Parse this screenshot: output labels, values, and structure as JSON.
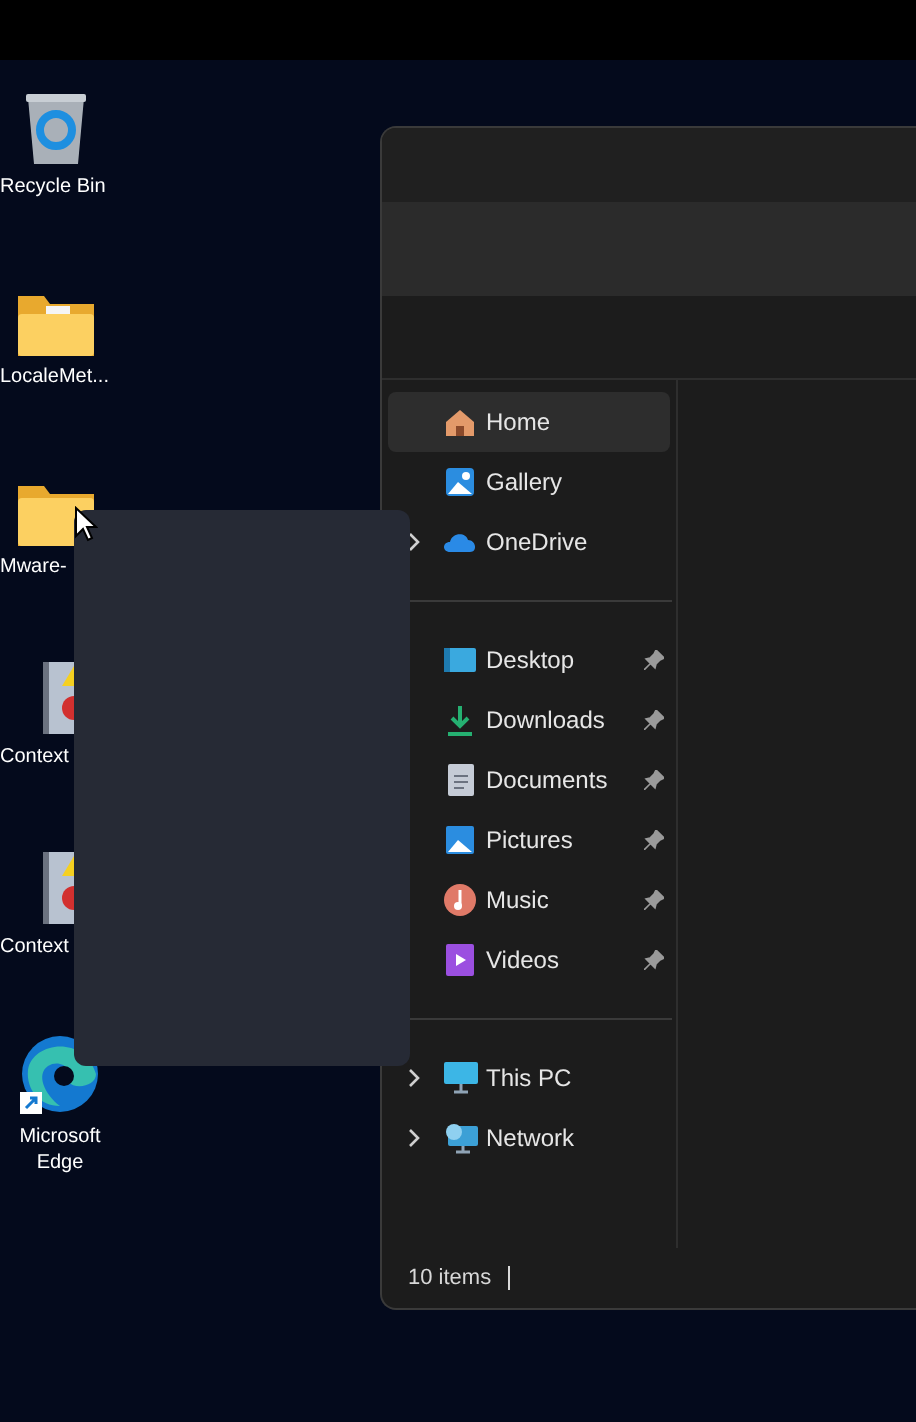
{
  "desktop_icons": [
    {
      "kind": "recycle",
      "label": "Recycle Bin"
    },
    {
      "kind": "folder-doc",
      "label": "LocaleMet..."
    },
    {
      "kind": "folder",
      "label": "Mware-"
    },
    {
      "kind": "log",
      "label": "Context"
    },
    {
      "kind": "log",
      "label": "Context"
    },
    {
      "kind": "edge",
      "label": "Microsoft Edge"
    }
  ],
  "explorer": {
    "nav_pane": {
      "groups": [
        [
          {
            "kind": "home",
            "label": "Home",
            "selected": true,
            "expandable": false,
            "pinned": false
          },
          {
            "kind": "gallery",
            "label": "Gallery",
            "selected": false,
            "expandable": false,
            "pinned": false
          },
          {
            "kind": "onedrive",
            "label": "OneDrive",
            "selected": false,
            "expandable": true,
            "pinned": false
          }
        ],
        [
          {
            "kind": "desktop",
            "label": "Desktop",
            "selected": false,
            "expandable": false,
            "pinned": true
          },
          {
            "kind": "downloads",
            "label": "Downloads",
            "selected": false,
            "expandable": false,
            "pinned": true
          },
          {
            "kind": "documents",
            "label": "Documents",
            "selected": false,
            "expandable": false,
            "pinned": true
          },
          {
            "kind": "pictures",
            "label": "Pictures",
            "selected": false,
            "expandable": false,
            "pinned": true
          },
          {
            "kind": "music",
            "label": "Music",
            "selected": false,
            "expandable": false,
            "pinned": true
          },
          {
            "kind": "videos",
            "label": "Videos",
            "selected": false,
            "expandable": false,
            "pinned": true
          }
        ],
        [
          {
            "kind": "pc",
            "label": "This PC",
            "selected": false,
            "expandable": true,
            "pinned": false
          },
          {
            "kind": "network",
            "label": "Network",
            "selected": false,
            "expandable": true,
            "pinned": false
          }
        ]
      ]
    },
    "status_bar": {
      "item_count": "10 items"
    }
  }
}
